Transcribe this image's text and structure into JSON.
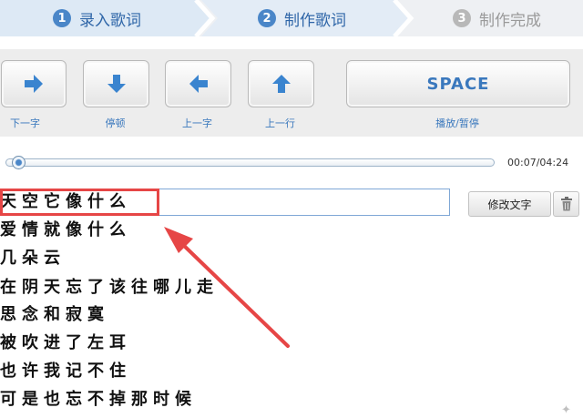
{
  "steps": [
    {
      "number": "1",
      "label": "录入歌词"
    },
    {
      "number": "2",
      "label": "制作歌词"
    },
    {
      "number": "3",
      "label": "制作完成"
    }
  ],
  "controls": {
    "next_char": "下一字",
    "pause": "停顿",
    "prev_char": "上一字",
    "prev_line": "上一行",
    "space_key": "SPACE",
    "play_pause": "播放/暂停"
  },
  "icons": {
    "next_char": "arrow-right-icon",
    "pause": "arrow-down-icon",
    "prev_char": "arrow-left-icon",
    "prev_line": "arrow-up-icon",
    "delete": "trash-icon"
  },
  "player": {
    "time": "00:07/04:24",
    "progress": 0.027
  },
  "lyrics": {
    "lines": [
      "天空它像什么",
      "爱情就像什么",
      "几朵云",
      "在阴天忘了该往哪儿走",
      "思念和寂寞",
      "被吹进了左耳",
      "也许我记不住",
      "可是也忘不掉那时候"
    ],
    "edit_label": "修改文字"
  },
  "colors": {
    "accent": "#3a78bd",
    "annotation": "#e64646"
  }
}
